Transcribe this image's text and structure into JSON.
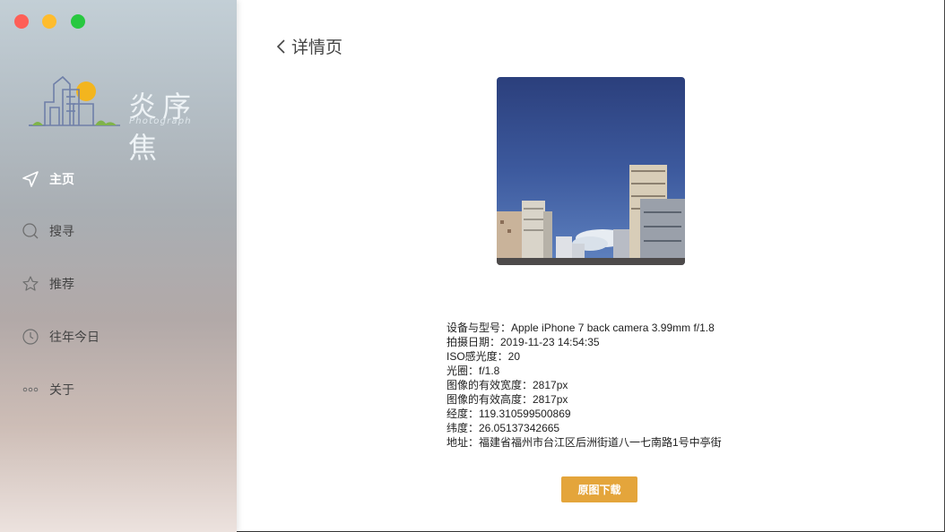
{
  "sidebar": {
    "logo": {
      "title": "炎序焦",
      "subtitle": "Photograph"
    },
    "items": [
      {
        "label": "主页",
        "icon": "navigation-arrow-icon",
        "active": true
      },
      {
        "label": "搜寻",
        "icon": "search-icon",
        "active": false
      },
      {
        "label": "推荐",
        "icon": "star-icon",
        "active": false
      },
      {
        "label": "往年今日",
        "icon": "clock-icon",
        "active": false
      },
      {
        "label": "关于",
        "icon": "more-dots-icon",
        "active": false
      }
    ]
  },
  "header": {
    "title": "详情页"
  },
  "details": [
    "设备与型号：Apple iPhone 7 back camera 3.99mm f/1.8",
    "拍摄日期：2019-11-23 14:54:35",
    "ISO感光度：20",
    "光圈：f/1.8",
    "图像的有效宽度：2817px",
    "图像的有效高度：2817px",
    "经度：119.310599500869",
    "纬度：26.05137342665",
    "地址：福建省福州市台江区后洲街道八一七南路1号中亭街"
  ],
  "actions": {
    "download": "原图下载"
  },
  "colors": {
    "accent": "#e4a53b",
    "sidebar_top": "#c3cfd6",
    "sidebar_bottom": "#ece2de"
  }
}
